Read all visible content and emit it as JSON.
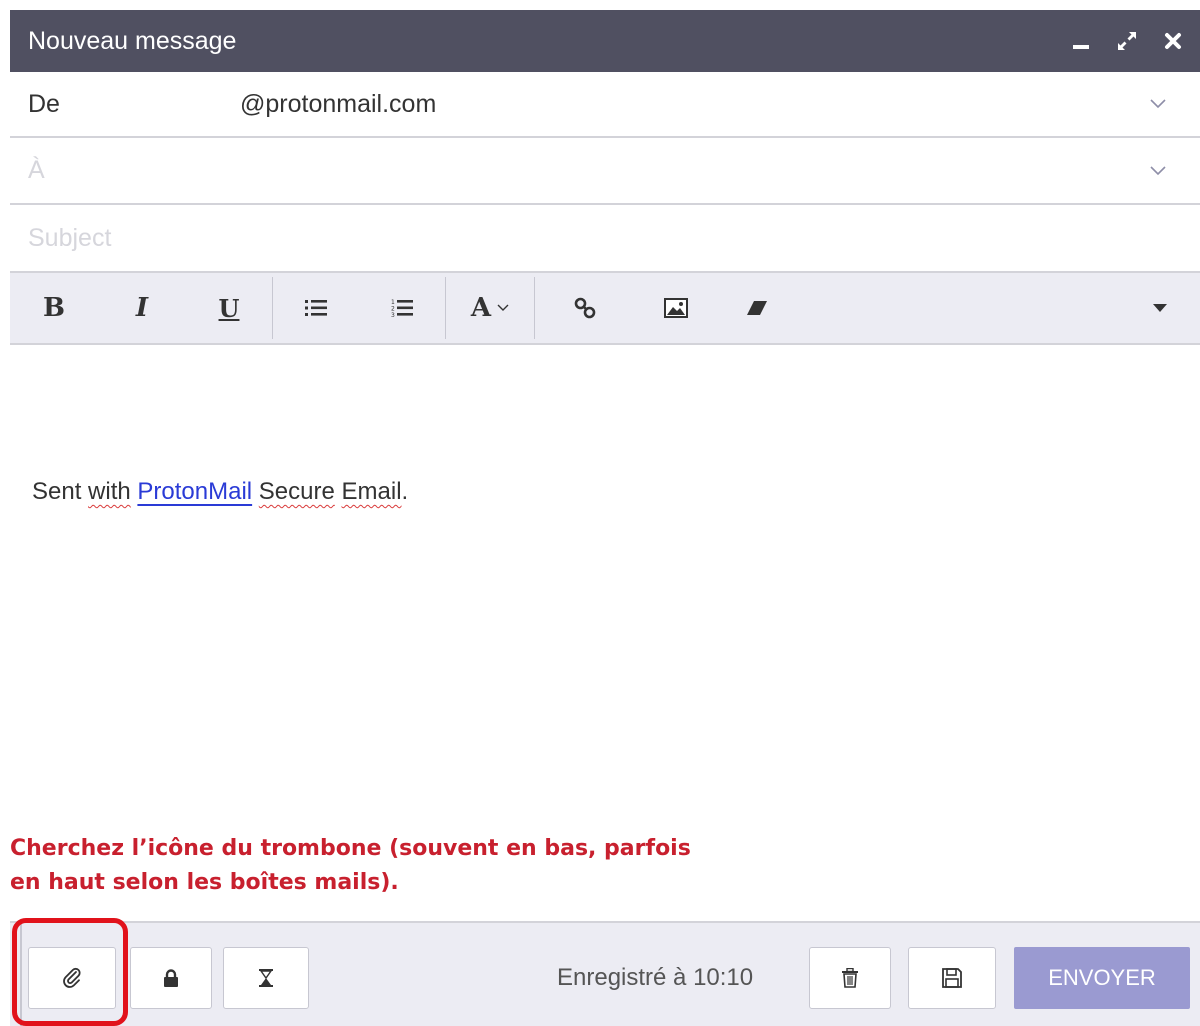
{
  "window": {
    "title": "Nouveau message",
    "controls": [
      "minimize-icon",
      "expand-icon",
      "close-icon"
    ]
  },
  "from": {
    "label": "De",
    "value": "@protonmail.com"
  },
  "to": {
    "placeholder": "À"
  },
  "subject": {
    "placeholder": "Subject"
  },
  "toolbar": {
    "bold": "B",
    "italic": "I",
    "underline": "U",
    "font": "A",
    "icons": [
      "bullet-list-icon",
      "numbered-list-icon",
      "font-dropdown-icon",
      "link-icon",
      "image-icon",
      "eraser-icon",
      "more-dropdown-icon"
    ]
  },
  "body": {
    "prefix": "Sent",
    "w1": "with",
    "link": "ProtonMail",
    "w2": "Secure",
    "w3": "Email",
    "end": "."
  },
  "annotation": {
    "line1": "Cherchez l’icône du trombone (souvent en bas, parfois",
    "line2": "en haut selon les boîtes mails).",
    "color": "#c8202e"
  },
  "footer": {
    "saved_text": "Enregistré à 10:10",
    "send_label": "ENVOYER",
    "icons": [
      "paperclip-icon",
      "lock-icon",
      "hourglass-icon",
      "trash-icon",
      "save-icon"
    ]
  },
  "colors": {
    "titlebar": "#505061",
    "toolbar_bg": "#ececf3",
    "send_button": "#9a9ad1",
    "highlight": "#e1121b",
    "link": "#2a3bd6"
  }
}
